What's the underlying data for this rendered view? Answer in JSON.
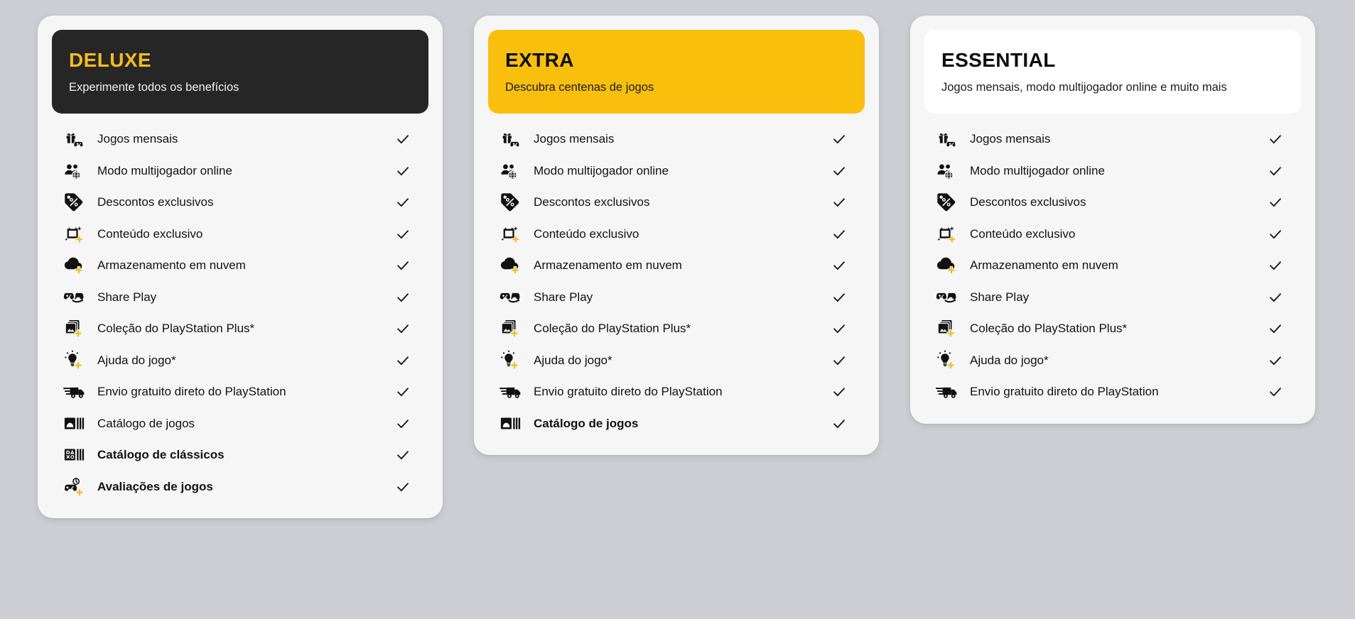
{
  "theme": {
    "page_background": "#cdced3",
    "card_background": "#f6f6f7",
    "dark_header": "#262626",
    "gold_header": "#f9bf0d",
    "white_header": "#ffffff",
    "accent_yellow": "#f2bc22",
    "text_dark": "#121212",
    "check_color": "#1a1a1a"
  },
  "check_glyph": "check-icon",
  "plans": [
    {
      "id": "deluxe",
      "name": "DELUXE",
      "subtitle": "Experimente todos os benefícios",
      "header_style": "dark",
      "features": [
        {
          "label": "Jogos mensais",
          "icon": "monthly-games-icon",
          "bold": false,
          "included": true
        },
        {
          "label": "Modo multijogador online",
          "icon": "online-multiplayer-icon",
          "bold": false,
          "included": true
        },
        {
          "label": "Descontos exclusivos",
          "icon": "exclusive-discounts-icon",
          "bold": false,
          "included": true
        },
        {
          "label": "Conteúdo exclusivo",
          "icon": "exclusive-content-icon",
          "bold": false,
          "included": true
        },
        {
          "label": "Armazenamento em nuvem",
          "icon": "cloud-storage-icon",
          "bold": false,
          "included": true
        },
        {
          "label": "Share Play",
          "icon": "share-play-icon",
          "bold": false,
          "included": true
        },
        {
          "label": "Coleção do PlayStation Plus*",
          "icon": "ps-plus-collection-icon",
          "bold": false,
          "included": true
        },
        {
          "label": "Ajuda do jogo*",
          "icon": "game-help-icon",
          "bold": false,
          "included": true
        },
        {
          "label": "Envio gratuito direto do PlayStation",
          "icon": "free-shipping-icon",
          "bold": false,
          "included": true
        },
        {
          "label": "Catálogo de jogos",
          "icon": "game-catalog-icon",
          "bold": false,
          "included": true
        },
        {
          "label": "Catálogo de clássicos",
          "icon": "classics-catalog-icon",
          "bold": true,
          "included": true
        },
        {
          "label": "Avaliações de jogos",
          "icon": "game-trials-icon",
          "bold": true,
          "included": true
        }
      ]
    },
    {
      "id": "extra",
      "name": "EXTRA",
      "subtitle": "Descubra centenas de jogos",
      "header_style": "gold",
      "features": [
        {
          "label": "Jogos mensais",
          "icon": "monthly-games-icon",
          "bold": false,
          "included": true
        },
        {
          "label": "Modo multijogador online",
          "icon": "online-multiplayer-icon",
          "bold": false,
          "included": true
        },
        {
          "label": "Descontos exclusivos",
          "icon": "exclusive-discounts-icon",
          "bold": false,
          "included": true
        },
        {
          "label": "Conteúdo exclusivo",
          "icon": "exclusive-content-icon",
          "bold": false,
          "included": true
        },
        {
          "label": "Armazenamento em nuvem",
          "icon": "cloud-storage-icon",
          "bold": false,
          "included": true
        },
        {
          "label": "Share Play",
          "icon": "share-play-icon",
          "bold": false,
          "included": true
        },
        {
          "label": "Coleção do PlayStation Plus*",
          "icon": "ps-plus-collection-icon",
          "bold": false,
          "included": true
        },
        {
          "label": "Ajuda do jogo*",
          "icon": "game-help-icon",
          "bold": false,
          "included": true
        },
        {
          "label": "Envio gratuito direto do PlayStation",
          "icon": "free-shipping-icon",
          "bold": false,
          "included": true
        },
        {
          "label": "Catálogo de jogos",
          "icon": "game-catalog-icon",
          "bold": true,
          "included": true
        }
      ]
    },
    {
      "id": "essential",
      "name": "ESSENTIAL",
      "subtitle": "Jogos mensais, modo multijogador online e muito mais",
      "header_style": "white",
      "features": [
        {
          "label": "Jogos mensais",
          "icon": "monthly-games-icon",
          "bold": false,
          "included": true
        },
        {
          "label": "Modo multijogador online",
          "icon": "online-multiplayer-icon",
          "bold": false,
          "included": true
        },
        {
          "label": "Descontos exclusivos",
          "icon": "exclusive-discounts-icon",
          "bold": false,
          "included": true
        },
        {
          "label": "Conteúdo exclusivo",
          "icon": "exclusive-content-icon",
          "bold": false,
          "included": true
        },
        {
          "label": "Armazenamento em nuvem",
          "icon": "cloud-storage-icon",
          "bold": false,
          "included": true
        },
        {
          "label": "Share Play",
          "icon": "share-play-icon",
          "bold": false,
          "included": true
        },
        {
          "label": "Coleção do PlayStation Plus*",
          "icon": "ps-plus-collection-icon",
          "bold": false,
          "included": true
        },
        {
          "label": "Ajuda do jogo*",
          "icon": "game-help-icon",
          "bold": false,
          "included": true
        },
        {
          "label": "Envio gratuito direto do PlayStation",
          "icon": "free-shipping-icon",
          "bold": false,
          "included": true
        }
      ]
    }
  ]
}
